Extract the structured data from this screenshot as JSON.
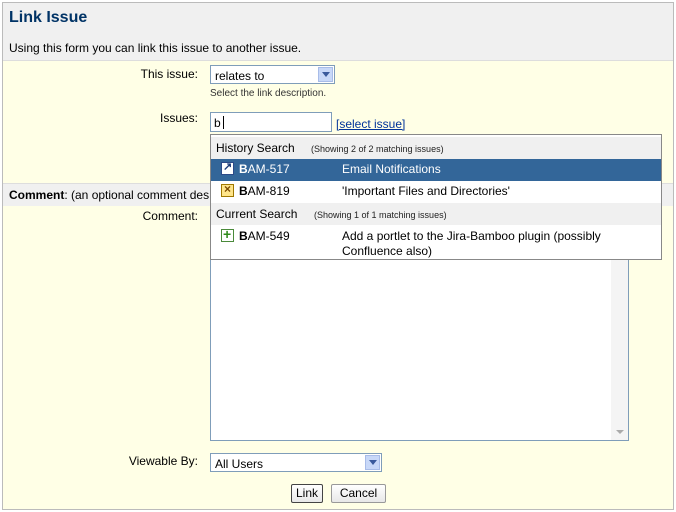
{
  "title": "Link Issue",
  "description": "Using this form you can link this issue to another issue.",
  "form": {
    "this_issue_label": "This issue:",
    "link_type_value": "relates to",
    "link_type_hint": "Select the link description.",
    "issues_label": "Issues:",
    "issues_value": "b",
    "select_issue_link": "[select issue]",
    "comment_bar_bold": "Comment",
    "comment_bar_rest": ": (an optional comment des",
    "comment_label": "Comment:",
    "viewable_label": "Viewable By:",
    "viewable_value": "All Users",
    "link_button": "Link",
    "cancel_button": "Cancel"
  },
  "popup": {
    "history": {
      "title": "History Search",
      "count": "(Showing 2 of 2 matching issues)",
      "items": [
        {
          "key_bold": "B",
          "key_rest": "AM-517",
          "summary": "Email Notifications",
          "icon": "link-icon",
          "selected": true
        },
        {
          "key_bold": "B",
          "key_rest": "AM-819",
          "summary": "'Important Files and Directories'",
          "icon": "task-icon",
          "selected": false
        }
      ]
    },
    "current": {
      "title": "Current Search",
      "count": "(Showing 1 of 1 matching issues)",
      "items": [
        {
          "key_bold": "B",
          "key_rest": "AM-549",
          "summary": "Add a portlet to the Jira-Bamboo plugin (possibly Confluence also)",
          "icon": "new-feature-icon",
          "selected": false
        }
      ]
    }
  },
  "colors": {
    "header_text": "#003366",
    "form_background": "#ffffe6",
    "selected_row": "#336699",
    "link": "#003399"
  }
}
